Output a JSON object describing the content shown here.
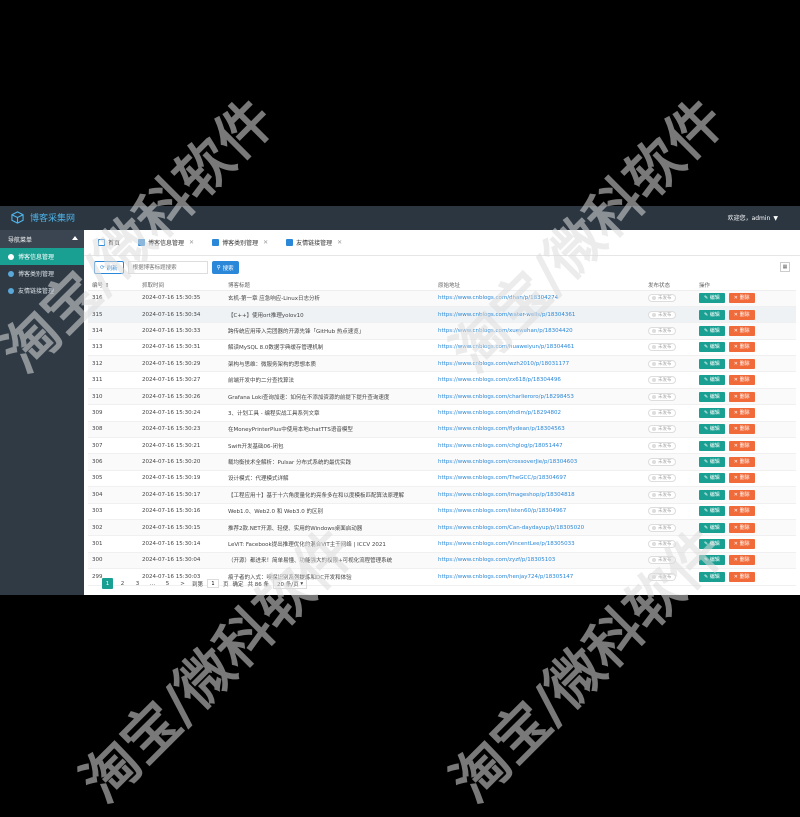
{
  "app": {
    "title": "博客采集网",
    "user_greeting": "欢迎您，admin"
  },
  "sidebar": {
    "header": "导航菜单",
    "items": [
      {
        "label": "博客信息管理",
        "active": true
      },
      {
        "label": "博客类别管理",
        "active": false
      },
      {
        "label": "友情链接管理",
        "active": false
      }
    ]
  },
  "tabs": [
    {
      "label": "首页",
      "icon": "home-icon"
    },
    {
      "label": "博客信息管理",
      "icon": "b-icon"
    },
    {
      "label": "博客类别管理",
      "icon": "list-icon"
    },
    {
      "label": "友情链接管理",
      "icon": "link-icon"
    }
  ],
  "toolbar": {
    "refresh_label": "刷新",
    "search_placeholder": "根据博客标题搜索",
    "search_label": "搜索"
  },
  "table": {
    "headers": [
      "编号",
      "抓取时间",
      "博客标题",
      "原始地址",
      "发布状态",
      "操作"
    ],
    "status_label": "未发布",
    "edit_label": "编辑",
    "delete_label": "删除",
    "rows": [
      [
        "316",
        "2024-07-16 15:30:35",
        "玄机-第一章 应急响应-Linux日志分析",
        "https://www.cnblogs.com/dhan/p/18304274"
      ],
      [
        "315",
        "2024-07-16 15:30:34",
        "【C++】使用ort推理yolov10",
        "https://www.cnblogs.com/water-wells/p/18304361"
      ],
      [
        "314",
        "2024-07-16 15:30:33",
        "跨传统应用带入完团器的开源先锋「GitHub 热点速览」",
        "https://www.cnblogs.com/xuewehan/p/18304420"
      ],
      [
        "313",
        "2024-07-16 15:30:31",
        "解读MySQL 8.0数据字典缓存管理机制",
        "https://www.cnblogs.com/huaweiyun/p/18304461"
      ],
      [
        "312",
        "2024-07-16 15:30:29",
        "架构与思维：微服务架构的思想本质",
        "https://www.cnblogs.com/wzh2010/p/18031177"
      ],
      [
        "311",
        "2024-07-16 15:30:27",
        "前端开发中的二分查找算法",
        "https://www.cnblogs.com/zx618/p/18304496"
      ],
      [
        "310",
        "2024-07-16 15:30:26",
        "Grafana Loki查询加速：如何在不添加资源的前提下提升查询速度",
        "https://www.cnblogs.com/charlieroro/p/18298453"
      ],
      [
        "309",
        "2024-07-16 15:30:24",
        "3、计划工具 - 编程实战工具系列文章",
        "https://www.cnblogs.com/zhdim/p/18294802"
      ],
      [
        "308",
        "2024-07-16 15:30:23",
        "在MoneyPrinterPlus中使用本地chatTTS语音模型",
        "https://www.cnblogs.com/flydean/p/18304563"
      ],
      [
        "307",
        "2024-07-16 15:30:21",
        "Swift开发基础06-闭包",
        "https://www.cnblogs.com/chglog/p/18051447"
      ],
      [
        "306",
        "2024-07-16 15:30:20",
        "载均衡技术全解析：Pulsar 分布式系统的最优实践",
        "https://www.cnblogs.com/crossoverJie/p/18304603"
      ],
      [
        "305",
        "2024-07-16 15:30:19",
        "设计模式：代理模式详解",
        "https://www.cnblogs.com/TheGCC/p/18304697"
      ],
      [
        "304",
        "2024-07-16 15:30:17",
        "【工程应用十】基于十六角度量化的亮条多在和以度模板匹配算法原理解",
        "https://www.cnblogs.com/Imageshop/p/18304818"
      ],
      [
        "303",
        "2024-07-16 15:30:16",
        "Web1.0、Web2.0 和 Web3.0 的区别",
        "https://www.cnblogs.com/listen60/p/18304967"
      ],
      [
        "302",
        "2024-07-16 15:30:15",
        "推荐2款.NET开源、轻便、实用的Windows桌面启动器",
        "https://www.cnblogs.com/Can-daydayup/p/18305020"
      ],
      [
        "301",
        "2024-07-16 15:30:14",
        "LeViT: Facebook提出推理优化的混合ViT主干网络 | ICCV 2021",
        "https://www.cnblogs.com/VincentLee/p/18305033"
      ],
      [
        "300",
        "2024-07-16 15:30:04",
        "（开源）都进来！简单易懂、功能强大的权限+可视化流程管理系统",
        "https://www.cnblogs.com/zyzf/p/18305103"
      ],
      [
        "299",
        "2024-07-16 15:30:03",
        "痕子者的入式：嗅探识别系列提炼和DC开发和体验",
        "https://www.cnblogs.com/henjay724/p/18305147"
      ]
    ]
  },
  "pager": {
    "pages": [
      "1",
      "2",
      "3",
      "...",
      "5"
    ],
    "prev": "<",
    "next": ">",
    "goto_label": "到第",
    "goto_value": "1",
    "page_unit": "页",
    "confirm": "确定",
    "total": "共 86 条",
    "page_size": "20 条/页"
  },
  "watermark": "淘宝/微科软件"
}
